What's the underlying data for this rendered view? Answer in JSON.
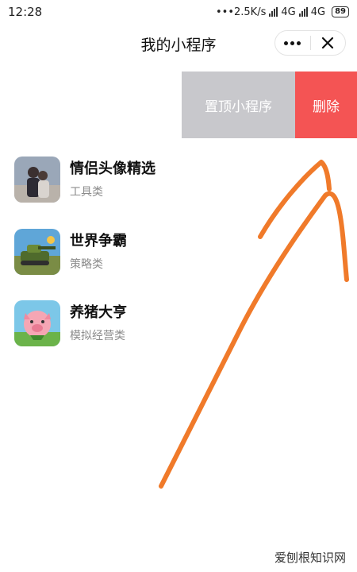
{
  "status": {
    "time": "12:28",
    "speed": "•••2.5K/s",
    "net1": "4G",
    "net2": "4G",
    "battery": "89"
  },
  "navbar": {
    "title": "我的小程序"
  },
  "swipe_actions": {
    "pin_label": "置顶小程序",
    "delete_label": "删除"
  },
  "apps": [
    {
      "name": "情侣头像精选",
      "category": "工具类"
    },
    {
      "name": "世界争霸",
      "category": "策略类"
    },
    {
      "name": "养猪大亨",
      "category": "模拟经营类"
    }
  ],
  "watermark": "爱刨根知识网",
  "colors": {
    "delete": "#f45454",
    "pin": "#c8c8cc",
    "scribble": "#f07a2a"
  }
}
